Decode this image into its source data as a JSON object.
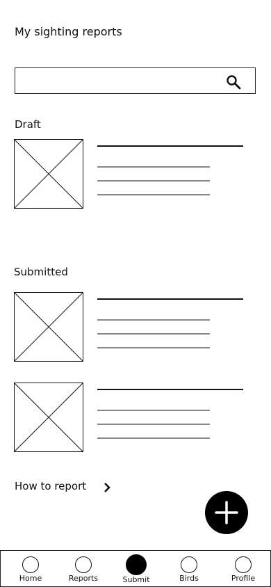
{
  "header": {
    "title": "My sighting reports"
  },
  "search": {
    "placeholder": "",
    "value": "",
    "icon": "search-icon"
  },
  "sections": {
    "draft": {
      "label": "Draft"
    },
    "submitted": {
      "label": "Submitted"
    }
  },
  "reports": {
    "draft": [
      {
        "thumbnail": "image-placeholder-icon"
      }
    ],
    "submitted": [
      {
        "thumbnail": "image-placeholder-icon"
      },
      {
        "thumbnail": "image-placeholder-icon"
      }
    ]
  },
  "help": {
    "how_to_report": "How to report",
    "icon": "chevron-right-icon"
  },
  "fab": {
    "icon": "plus-icon"
  },
  "bottom_nav": {
    "items": [
      {
        "label": "Home",
        "icon": "home-icon",
        "active": false
      },
      {
        "label": "Reports",
        "icon": "reports-icon",
        "active": false
      },
      {
        "label": "Submit",
        "icon": "submit-icon",
        "active": true
      },
      {
        "label": "Birds",
        "icon": "birds-icon",
        "active": false
      },
      {
        "label": "Profile",
        "icon": "profile-icon",
        "active": false
      }
    ]
  },
  "colors": {
    "foreground": "#111111",
    "subline": "#888888",
    "background": "#ffffff",
    "accent": "#000000"
  }
}
